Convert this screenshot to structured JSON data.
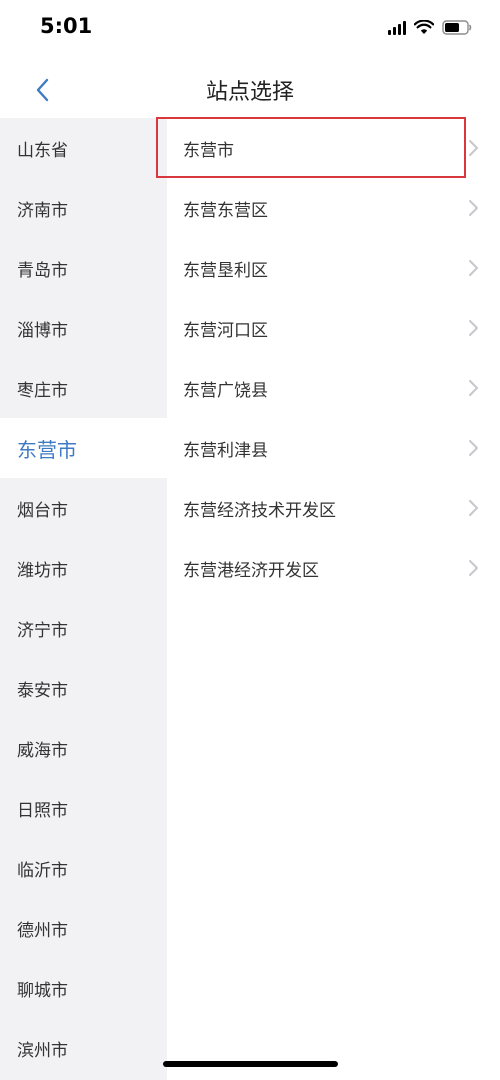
{
  "status": {
    "time": "5:01"
  },
  "header": {
    "title": "站点选择"
  },
  "sidebar": {
    "items": [
      {
        "label": "山东省",
        "active": false
      },
      {
        "label": "济南市",
        "active": false
      },
      {
        "label": "青岛市",
        "active": false
      },
      {
        "label": "淄博市",
        "active": false
      },
      {
        "label": "枣庄市",
        "active": false
      },
      {
        "label": "东营市",
        "active": true
      },
      {
        "label": "烟台市",
        "active": false
      },
      {
        "label": "潍坊市",
        "active": false
      },
      {
        "label": "济宁市",
        "active": false
      },
      {
        "label": "泰安市",
        "active": false
      },
      {
        "label": "威海市",
        "active": false
      },
      {
        "label": "日照市",
        "active": false
      },
      {
        "label": "临沂市",
        "active": false
      },
      {
        "label": "德州市",
        "active": false
      },
      {
        "label": "聊城市",
        "active": false
      },
      {
        "label": "滨州市",
        "active": false
      }
    ]
  },
  "cities": {
    "items": [
      {
        "label": "东营市"
      },
      {
        "label": "东营东营区"
      },
      {
        "label": "东营垦利区"
      },
      {
        "label": "东营河口区"
      },
      {
        "label": "东营广饶县"
      },
      {
        "label": "东营利津县"
      },
      {
        "label": "东营经济技术开发区"
      },
      {
        "label": "东营港经济开发区"
      }
    ]
  },
  "colors": {
    "accent": "#3f7bc5",
    "sidebar_bg": "#f2f2f4",
    "highlight_border": "#d9373e",
    "chevron": "#c7c7cc"
  }
}
